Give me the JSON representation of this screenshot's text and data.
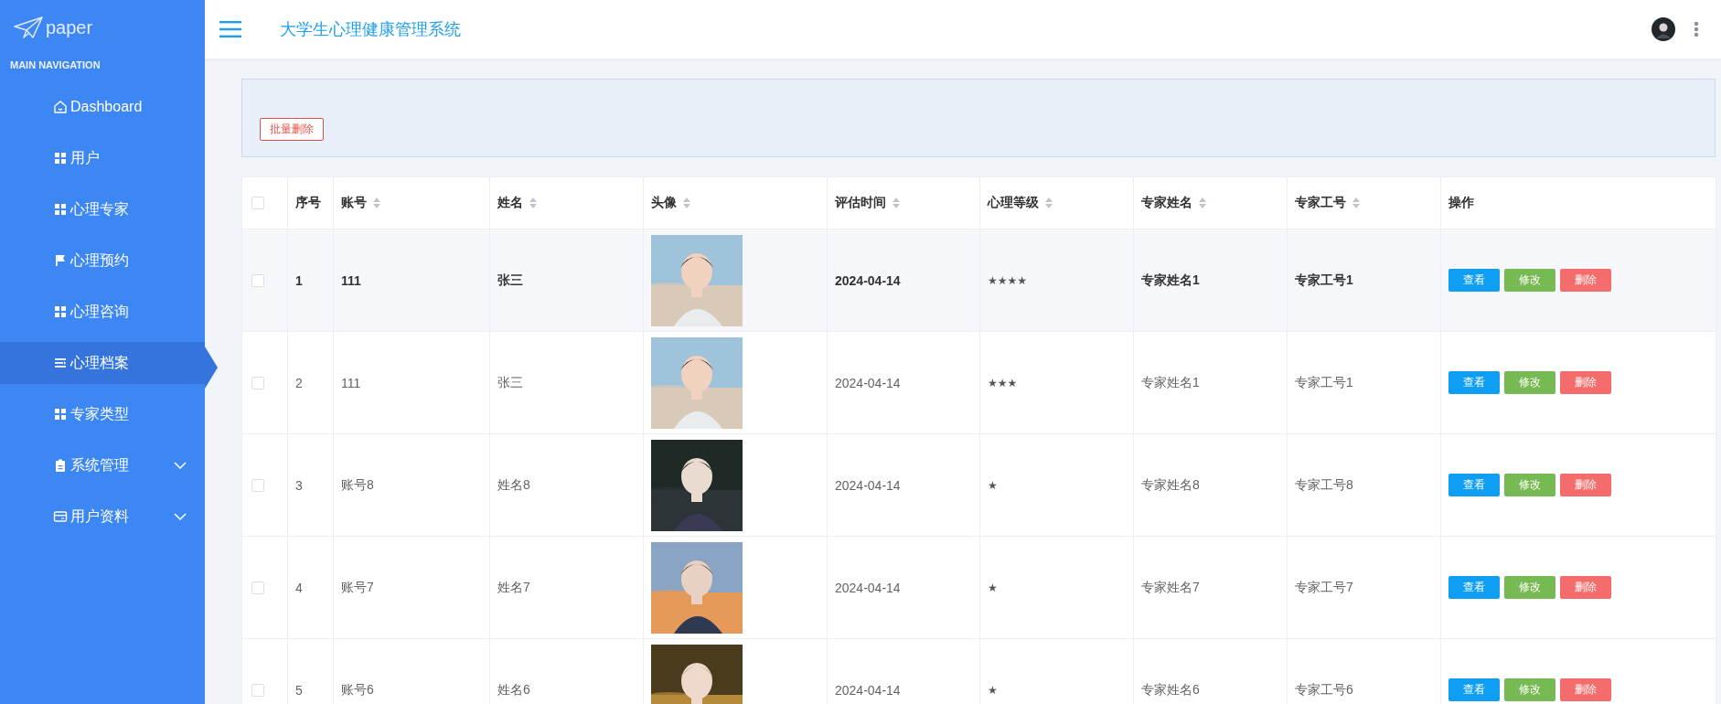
{
  "sidebar": {
    "logo": "paper",
    "heading": "MAIN NAVIGATION",
    "items": [
      {
        "label": "Dashboard",
        "kind": "home",
        "selected": false,
        "has_submenu": false
      },
      {
        "label": "用户",
        "kind": "grid",
        "selected": false,
        "has_submenu": false
      },
      {
        "label": "心理专家",
        "kind": "grid",
        "selected": false,
        "has_submenu": false
      },
      {
        "label": "心理预约",
        "kind": "flag",
        "selected": false,
        "has_submenu": false
      },
      {
        "label": "心理咨询",
        "kind": "grid",
        "selected": false,
        "has_submenu": false
      },
      {
        "label": "心理档案",
        "kind": "list",
        "selected": true,
        "has_submenu": false
      },
      {
        "label": "专家类型",
        "kind": "grid",
        "selected": false,
        "has_submenu": false
      },
      {
        "label": "系统管理",
        "kind": "clipboard",
        "selected": false,
        "has_submenu": true
      },
      {
        "label": "用户资料",
        "kind": "card",
        "selected": false,
        "has_submenu": true
      }
    ]
  },
  "header": {
    "title": "大学生心理健康管理系统"
  },
  "toolbar": {
    "batch_delete": "批量删除"
  },
  "table": {
    "select_all_checked": false,
    "columns": [
      {
        "label": "序号",
        "sortable": false
      },
      {
        "label": "账号",
        "sortable": true
      },
      {
        "label": "姓名",
        "sortable": true
      },
      {
        "label": "头像",
        "sortable": true
      },
      {
        "label": "评估时间",
        "sortable": true
      },
      {
        "label": "心理等级",
        "sortable": true
      },
      {
        "label": "专家姓名",
        "sortable": true
      },
      {
        "label": "专家工号",
        "sortable": true
      },
      {
        "label": "操作",
        "sortable": false
      }
    ],
    "rows": [
      {
        "hovered": true,
        "checked": false,
        "index": "1",
        "account": "111",
        "name": "张三",
        "date": "2024-04-14",
        "rating": "★★★★",
        "expert_name": "专家姓名1",
        "expert_id": "专家工号1",
        "actions": [
          {
            "label": "查看",
            "kind": "view"
          },
          {
            "label": "修改",
            "kind": "edit"
          },
          {
            "label": "删除",
            "kind": "delete"
          }
        ]
      },
      {
        "hovered": false,
        "checked": false,
        "index": "2",
        "account": "111",
        "name": "张三",
        "date": "2024-04-14",
        "rating": "★★★",
        "expert_name": "专家姓名1",
        "expert_id": "专家工号1",
        "actions": [
          {
            "label": "查看",
            "kind": "view"
          },
          {
            "label": "修改",
            "kind": "edit"
          },
          {
            "label": "删除",
            "kind": "delete"
          }
        ]
      },
      {
        "hovered": false,
        "checked": false,
        "index": "3",
        "account": "账号8",
        "name": "姓名8",
        "date": "2024-04-14",
        "rating": "★",
        "expert_name": "专家姓名8",
        "expert_id": "专家工号8",
        "actions": [
          {
            "label": "查看",
            "kind": "view"
          },
          {
            "label": "修改",
            "kind": "edit"
          },
          {
            "label": "删除",
            "kind": "delete"
          }
        ]
      },
      {
        "hovered": false,
        "checked": false,
        "index": "4",
        "account": "账号7",
        "name": "姓名7",
        "date": "2024-04-14",
        "rating": "★",
        "expert_name": "专家姓名7",
        "expert_id": "专家工号7",
        "actions": [
          {
            "label": "查看",
            "kind": "view"
          },
          {
            "label": "修改",
            "kind": "edit"
          },
          {
            "label": "删除",
            "kind": "delete"
          }
        ]
      },
      {
        "hovered": false,
        "checked": false,
        "index": "5",
        "account": "账号6",
        "name": "姓名6",
        "date": "2024-04-14",
        "rating": "★",
        "expert_name": "专家姓名6",
        "expert_id": "专家工号6",
        "actions": [
          {
            "label": "查看",
            "kind": "view"
          },
          {
            "label": "修改",
            "kind": "edit"
          },
          {
            "label": "删除",
            "kind": "delete"
          }
        ]
      }
    ]
  }
}
